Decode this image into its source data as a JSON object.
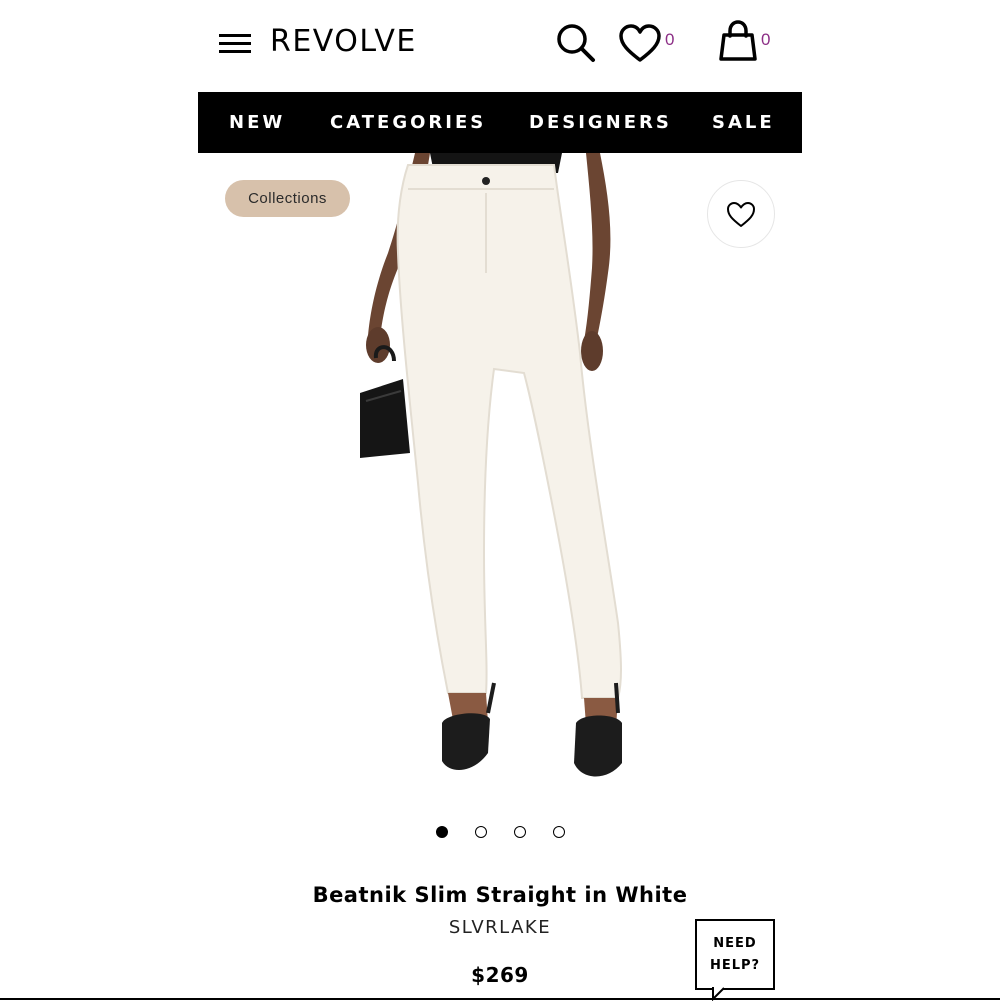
{
  "header": {
    "logo": "REVOLVE",
    "menu_icon": "hamburger-menu-icon",
    "search_icon": "search-icon",
    "wishlist_icon": "heart-icon",
    "wishlist_count": "0",
    "bag_icon": "shopping-bag-icon",
    "bag_count": "0",
    "count_color": "#8c2e86"
  },
  "nav": {
    "items": [
      {
        "label": "NEW"
      },
      {
        "label": "CATEGORIES"
      },
      {
        "label": "DESIGNERS"
      },
      {
        "label": "SALE"
      }
    ]
  },
  "product": {
    "badge": "Collections",
    "favorite_icon": "heart-outline-icon",
    "image_count": 4,
    "active_image": 1,
    "title": "Beatnik Slim Straight in White",
    "brand": "SLVRLAKE",
    "price": "$269"
  },
  "help": {
    "line1": "NEED",
    "line2": "HELP?"
  },
  "colors": {
    "nav_bg": "#000000",
    "badge_bg": "#d7c1ab"
  }
}
